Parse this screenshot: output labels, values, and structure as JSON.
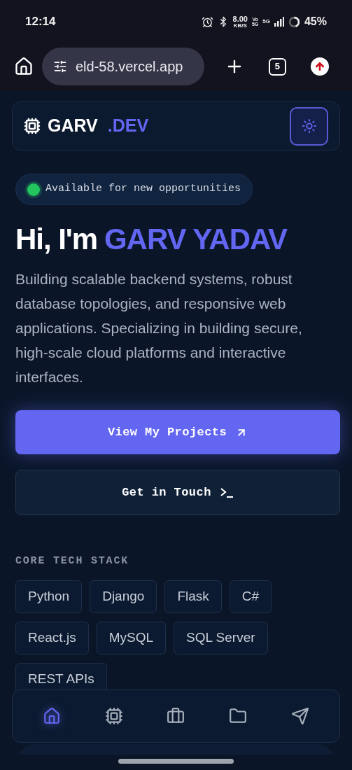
{
  "status_bar": {
    "time": "12:14",
    "speed": "8.00",
    "speed_unit": "KB/S",
    "volte": "Vo",
    "volte_sub": "5G",
    "network": "5G",
    "battery": "45%"
  },
  "browser": {
    "url": "eld-58.vercel.app",
    "tab_count": "5"
  },
  "header": {
    "logo_name": "GARV",
    "logo_suffix": ".DEV"
  },
  "badge": {
    "text": "Available for new opportunities",
    "color": "#22c55e"
  },
  "hero": {
    "greeting": "Hi, I'm",
    "name": "GARV YADAV",
    "description": "Building scalable backend systems, robust database topologies, and responsive web applications. Specializing in building secure, high-scale cloud platforms and interactive interfaces."
  },
  "buttons": [
    {
      "label": "View My Projects",
      "kind": "primary"
    },
    {
      "label": "Get in Touch",
      "kind": "secondary"
    }
  ],
  "tech_stack": {
    "title": "CORE TECH STACK",
    "items": [
      "Python",
      "Django",
      "Flask",
      "C#",
      "React.js",
      "MySQL",
      "SQL Server",
      "REST APIs"
    ]
  },
  "bottom_nav": [
    {
      "kind": "home",
      "selected": true
    },
    {
      "kind": "chip",
      "selected": false
    },
    {
      "kind": "briefcase",
      "selected": false
    },
    {
      "kind": "folder",
      "selected": false
    },
    {
      "kind": "send",
      "selected": false
    }
  ]
}
